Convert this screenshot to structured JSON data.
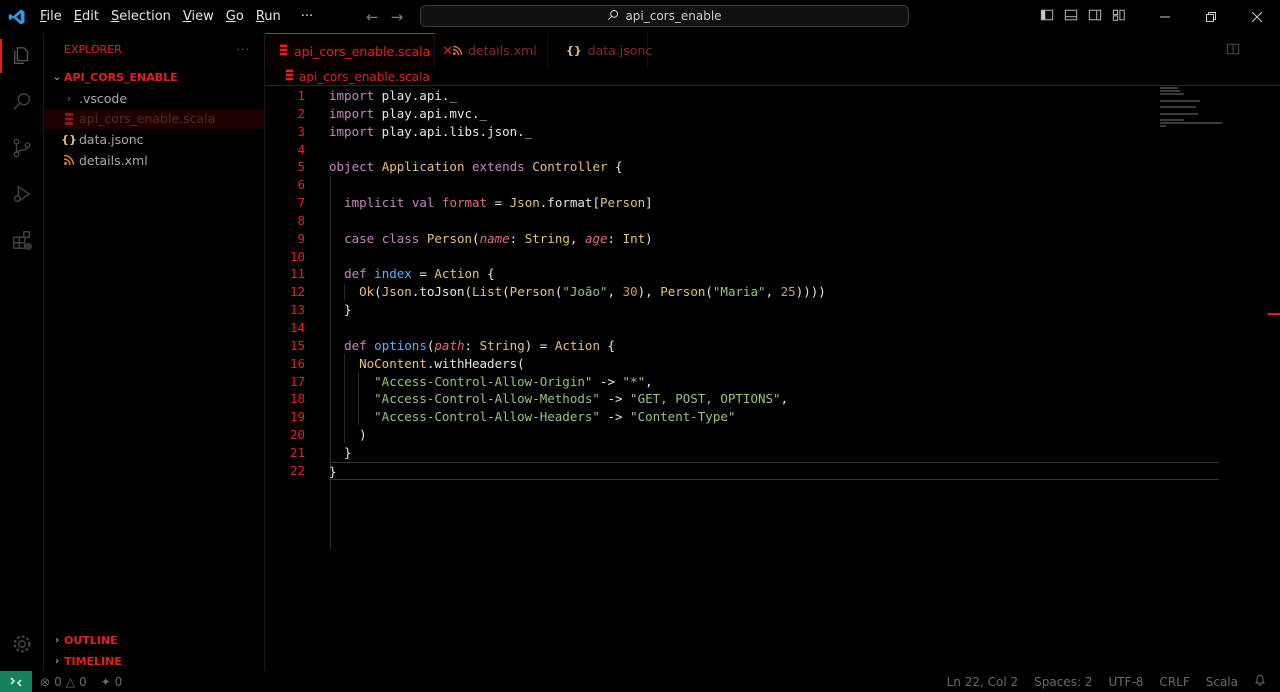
{
  "titlebar": {
    "menu": [
      {
        "label": "File",
        "mnemonic": "F",
        "rest": "ile"
      },
      {
        "label": "Edit",
        "mnemonic": "E",
        "rest": "dit"
      },
      {
        "label": "Selection",
        "mnemonic": "S",
        "rest": "election"
      },
      {
        "label": "View",
        "mnemonic": "V",
        "rest": "iew"
      },
      {
        "label": "Go",
        "mnemonic": "G",
        "rest": "o"
      },
      {
        "label": "Run",
        "mnemonic": "R",
        "rest": "un"
      }
    ],
    "more": "···",
    "search": "api_cors_enable"
  },
  "sidebar": {
    "header": "EXPLORER",
    "more": "···",
    "folder": "API_CORS_ENABLE",
    "items": [
      {
        "label": ".vscode",
        "type": "folder"
      },
      {
        "label": "api_cors_enable.scala",
        "type": "scala"
      },
      {
        "label": "data.jsonc",
        "type": "json"
      },
      {
        "label": "details.xml",
        "type": "xml"
      }
    ],
    "outline": "OUTLINE",
    "timeline": "TIMELINE"
  },
  "tabs": [
    {
      "label": "api_cors_enable.scala",
      "icon": "scala-icon",
      "active": true
    },
    {
      "label": "details.xml",
      "icon": "rss-icon",
      "active": false
    },
    {
      "label": "data.jsonc",
      "icon": "braces-icon",
      "active": false
    }
  ],
  "breadcrumb": "api_cors_enable.scala",
  "editor": {
    "line_numbers": [
      "1",
      "2",
      "3",
      "4",
      "5",
      "6",
      "7",
      "8",
      "9",
      "10",
      "11",
      "12",
      "13",
      "14",
      "15",
      "16",
      "17",
      "18",
      "19",
      "20",
      "21",
      "22"
    ],
    "current_line": 22
  },
  "statusbar": {
    "errors": "0",
    "warnings": "0",
    "ports": "0",
    "position": "Ln 22, Col 2",
    "spaces": "Spaces: 2",
    "encoding": "UTF-8",
    "eol": "CRLF",
    "language": "Scala"
  },
  "colors": {
    "accent": "#e51f1f",
    "background": "#000000",
    "remote": "#16825d"
  }
}
